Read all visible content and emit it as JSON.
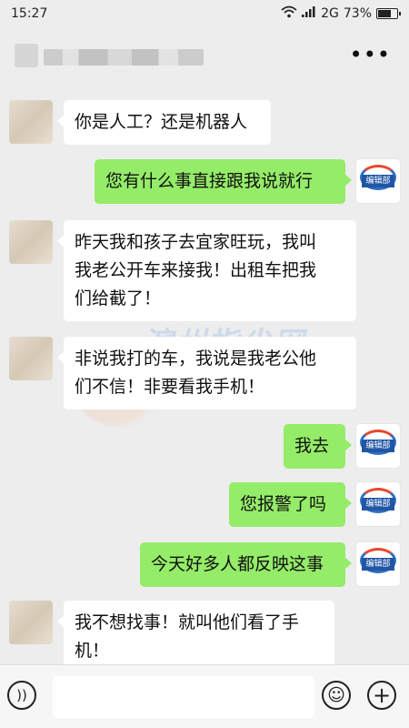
{
  "status_bar": {
    "time": "15:27",
    "network": "2G",
    "battery_text": "73%",
    "battery_level": 0.73
  },
  "messages": [
    {
      "side": "left",
      "text": "你是人工？还是机器人"
    },
    {
      "side": "right",
      "text": "您有什么事直接跟我说就行"
    },
    {
      "side": "left",
      "text": "昨天我和孩子去宜家旺玩，我叫\n我老公开车来接我！出租车把我\n们给截了！"
    },
    {
      "side": "left",
      "text": "非说我打的车，我说是我老公他\n们不信！非要看我手机！"
    },
    {
      "side": "right",
      "text": "我去"
    },
    {
      "side": "right",
      "text": "您报警了吗"
    },
    {
      "side": "right",
      "text": "今天好多人都反映这事"
    },
    {
      "side": "left",
      "text": "我不想找事！就叫他们看了手\n机！"
    }
  ],
  "editor_badge": "编辑部",
  "watermark": {
    "title": "滨州指尖网",
    "subtitle": "公众号"
  },
  "input": {
    "value": ""
  },
  "icons": {
    "more": "more-icon",
    "voice": "voice-icon",
    "emoji": "emoji-icon",
    "plus": "plus-icon"
  },
  "colors": {
    "background": "#ededed",
    "outgoing_bubble": "#95ec69",
    "incoming_bubble": "#ffffff"
  }
}
